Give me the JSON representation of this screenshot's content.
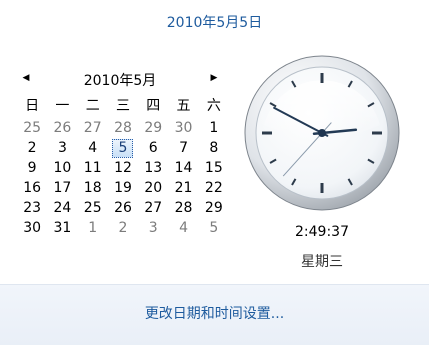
{
  "header": {
    "date": "2010年5月5日"
  },
  "calendar": {
    "month_label": "2010年5月",
    "prev_icon": "left-triangle-icon",
    "next_icon": "right-triangle-icon",
    "weekdays": [
      "日",
      "一",
      "二",
      "三",
      "四",
      "五",
      "六"
    ],
    "weeks": [
      [
        "25",
        "26",
        "27",
        "28",
        "29",
        "30",
        "1"
      ],
      [
        "2",
        "3",
        "4",
        "5",
        "6",
        "7",
        "8"
      ],
      [
        "9",
        "10",
        "11",
        "12",
        "13",
        "14",
        "15"
      ],
      [
        "16",
        "17",
        "18",
        "19",
        "20",
        "21",
        "22"
      ],
      [
        "23",
        "24",
        "25",
        "26",
        "27",
        "28",
        "29"
      ],
      [
        "30",
        "31",
        "1",
        "2",
        "3",
        "4",
        "5"
      ]
    ],
    "selected_day": "5"
  },
  "clock": {
    "time": "2:49:37",
    "weekday": "星期三",
    "hands": {
      "hour": 2,
      "minute": 49,
      "second": 37
    }
  },
  "footer": {
    "link": "更改日期和时间设置..."
  },
  "colors": {
    "link": "#1e5b9e",
    "other_month": "#7c7c7c",
    "selection": "#c9e0f7"
  }
}
